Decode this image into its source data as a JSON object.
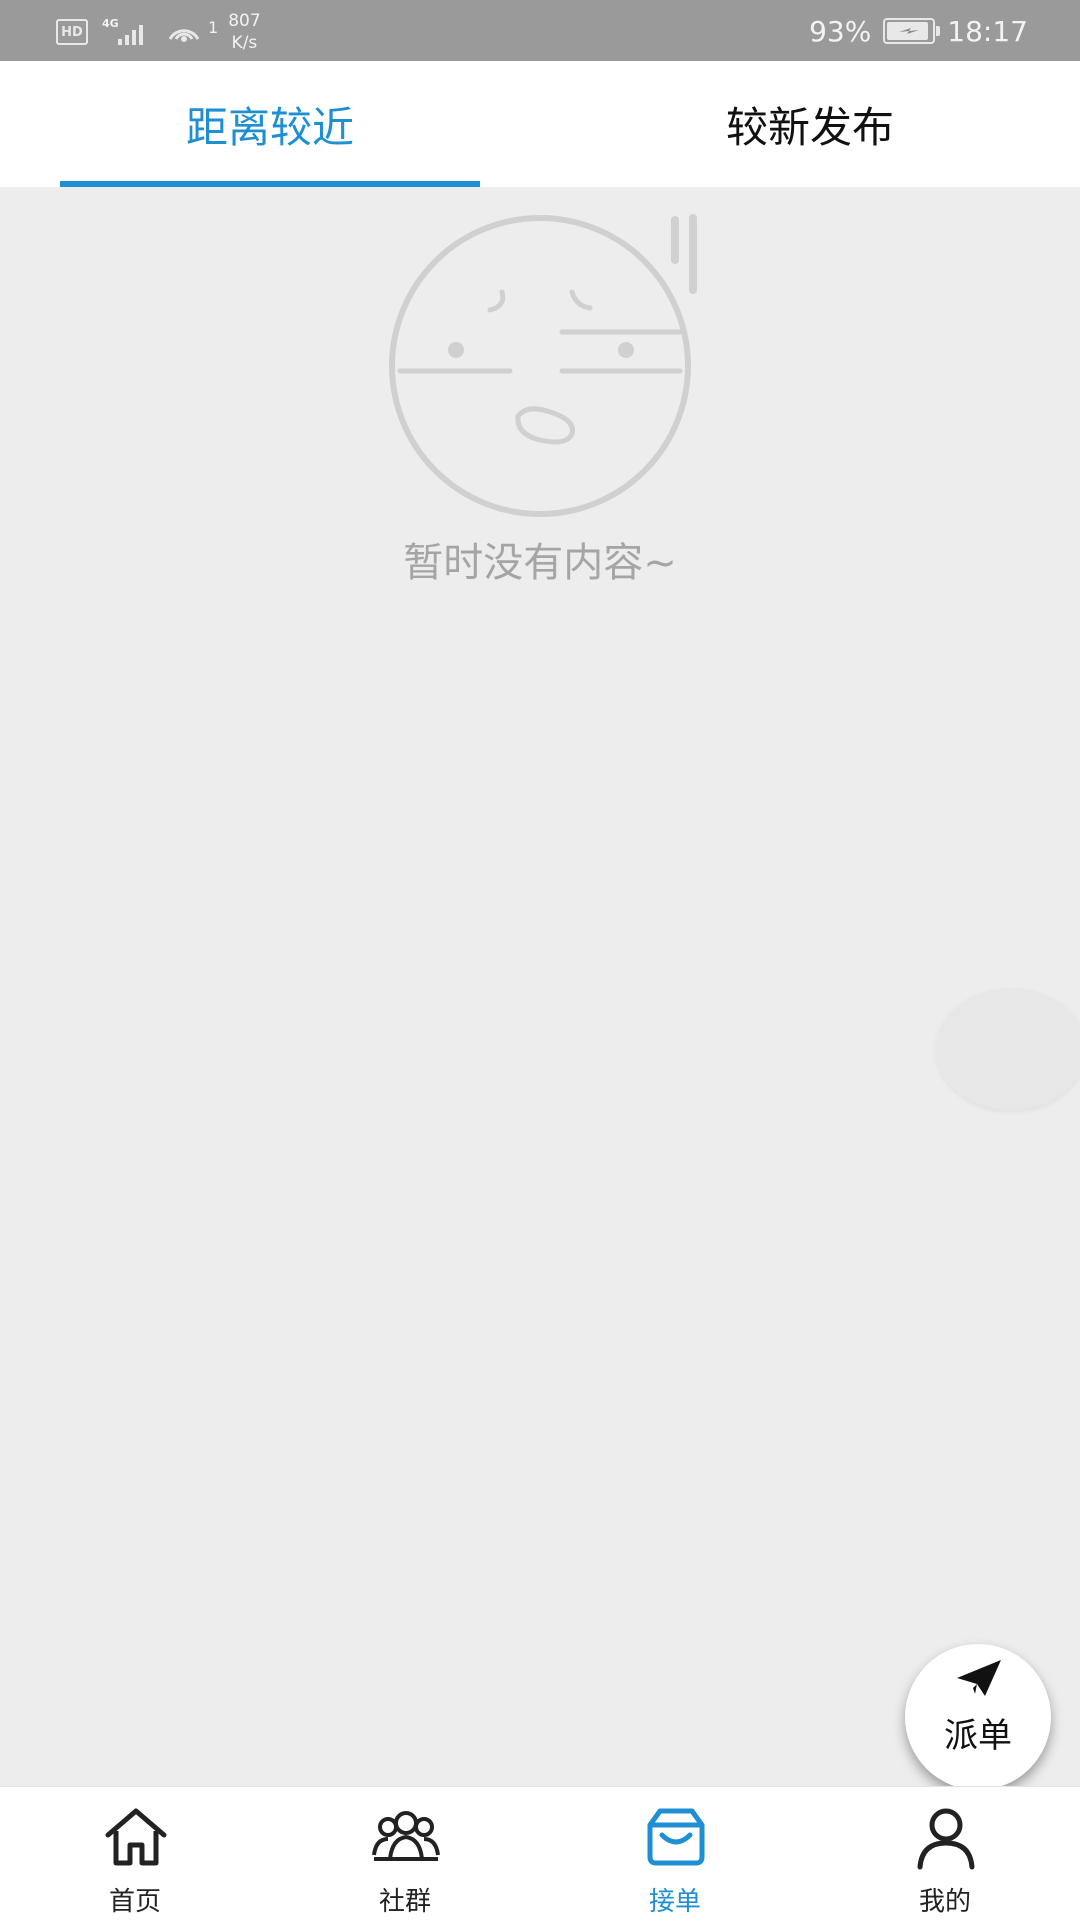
{
  "status_bar": {
    "hd": "HD",
    "network": "4G",
    "signal_sup": "1",
    "speed_value": "807",
    "speed_unit": "K/s",
    "battery": "93%",
    "battery_level": 0.93,
    "time": "18:17"
  },
  "tabs": [
    {
      "label": "距离较近",
      "active": true
    },
    {
      "label": "较新发布",
      "active": false
    }
  ],
  "empty_state": {
    "message": "暂时没有内容~",
    "icon": "sad-face-icon"
  },
  "fab": {
    "label": "派单",
    "icon": "paper-plane-icon"
  },
  "bottom_nav": [
    {
      "label": "首页",
      "icon": "home-icon",
      "active": false
    },
    {
      "label": "社群",
      "icon": "community-icon",
      "active": false
    },
    {
      "label": "接单",
      "icon": "inbox-icon",
      "active": true
    },
    {
      "label": "我的",
      "icon": "user-icon",
      "active": false
    }
  ],
  "colors": {
    "accent": "#1e8fd2",
    "background": "#ededed",
    "status_bar": "#9a9a9a"
  }
}
